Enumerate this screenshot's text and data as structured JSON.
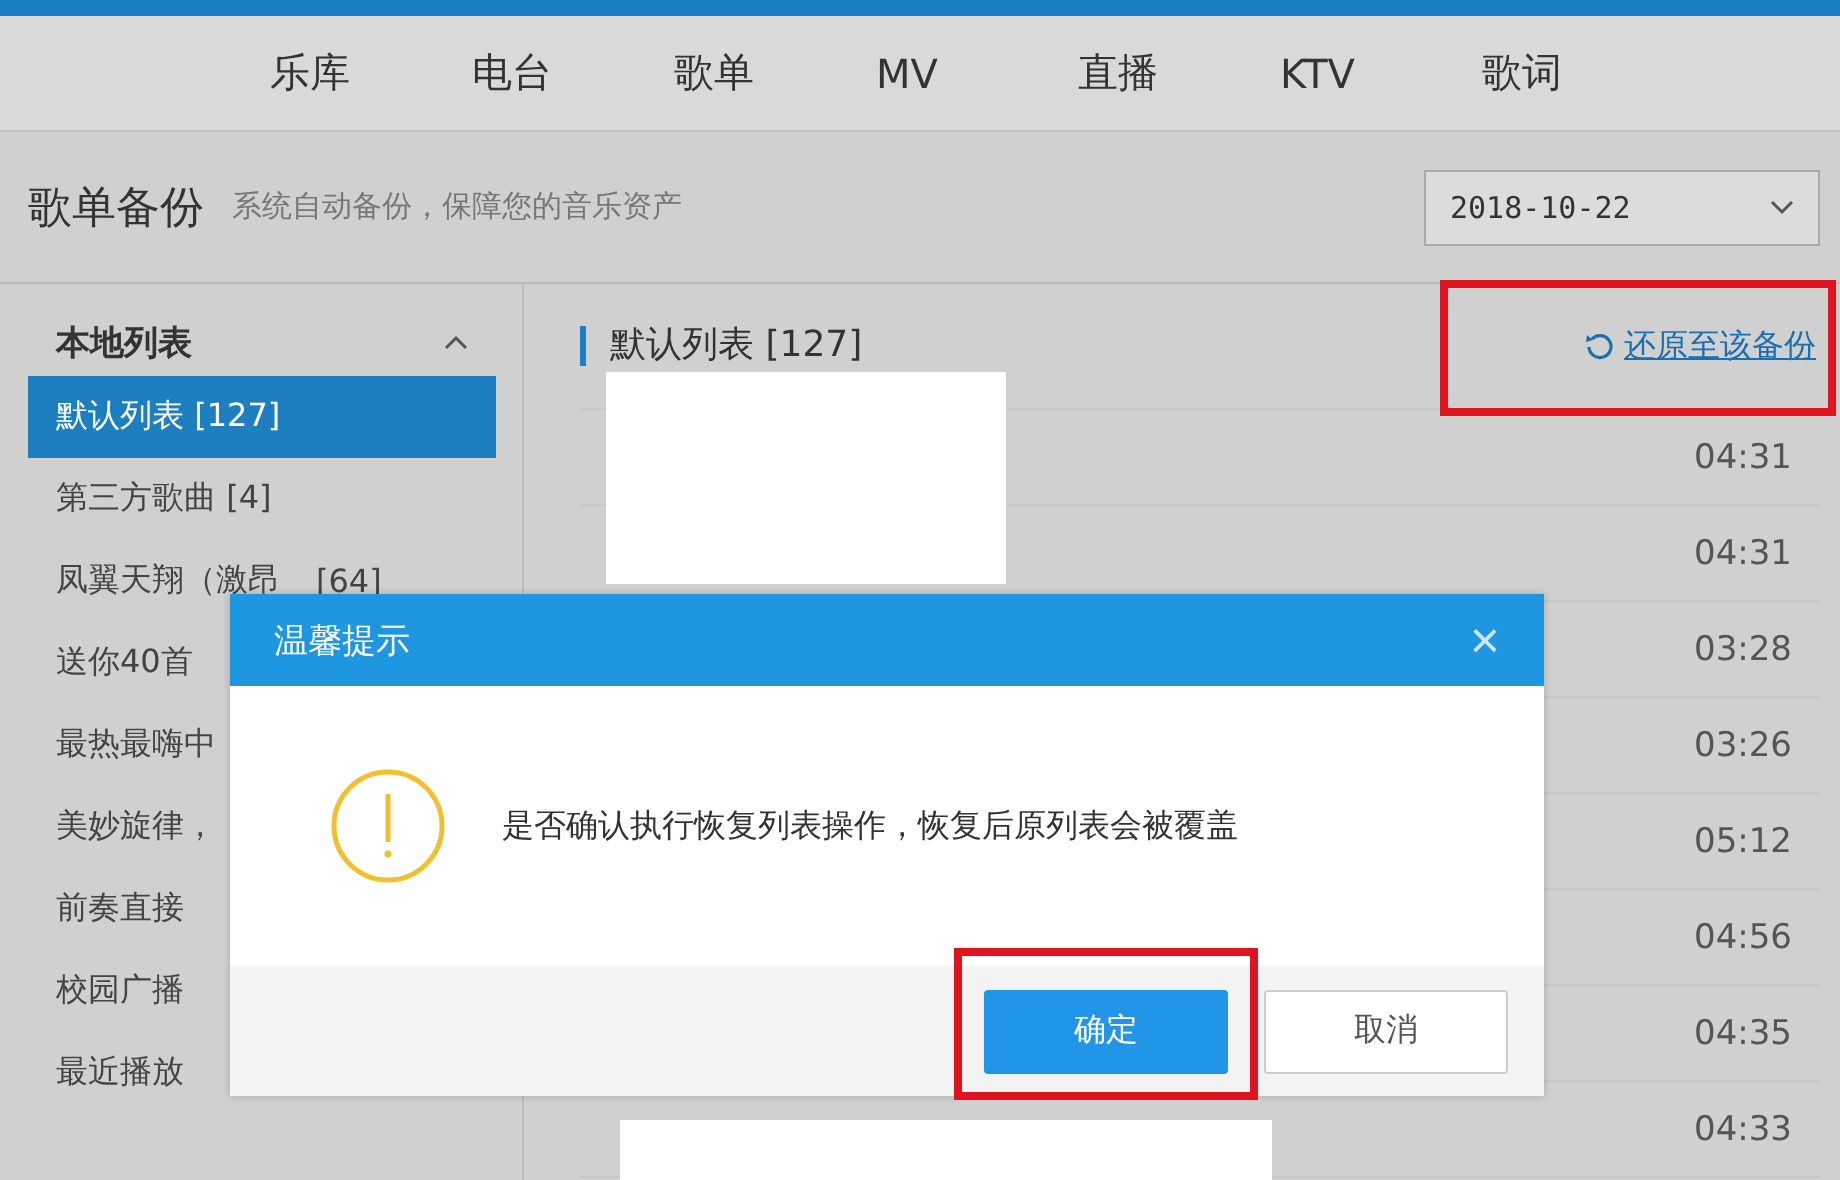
{
  "nav": [
    {
      "label": "乐库",
      "selected": false
    },
    {
      "label": "电台",
      "selected": false
    },
    {
      "label": "歌单",
      "selected": false
    },
    {
      "label": "MV",
      "selected": false
    },
    {
      "label": "直播",
      "selected": false
    },
    {
      "label": "KTV",
      "selected": false
    },
    {
      "label": "歌词",
      "selected": false
    }
  ],
  "header": {
    "title": "歌单备份",
    "subtitle": "系统自动备份，保障您的音乐资产",
    "date": "2018-10-22"
  },
  "sidebar": {
    "heading": "本地列表",
    "expanded": true,
    "items": [
      {
        "label": "默认列表 [127]",
        "selected": true
      },
      {
        "label": "第三方歌曲 [4]",
        "selected": false
      },
      {
        "label": "凤翼天翔（激昂",
        "count": "[64]",
        "selected": false
      },
      {
        "label": "送你40首",
        "selected": false
      },
      {
        "label": "最热最嗨中",
        "selected": false
      },
      {
        "label": "美妙旋律，",
        "selected": false
      },
      {
        "label": "前奏直接",
        "selected": false
      },
      {
        "label": "校园广播",
        "selected": false
      },
      {
        "label": "最近播放",
        "selected": false
      }
    ]
  },
  "content": {
    "title": "默认列表 [127]",
    "restore_link": {
      "label": "还原至该备份",
      "highlighted": true
    },
    "durations": [
      "04:31",
      "04:31",
      "03:28",
      "03:26",
      "05:12",
      "04:56",
      "04:35",
      "04:33"
    ]
  },
  "dialog": {
    "title": "温馨提示",
    "close": "×",
    "message": "是否确认执行恢复列表操作，恢复后原列表会被覆盖",
    "buttons": [
      {
        "label": "确定",
        "kind": "primary",
        "highlighted": true
      },
      {
        "label": "取消",
        "kind": "secondary",
        "highlighted": false
      }
    ]
  }
}
